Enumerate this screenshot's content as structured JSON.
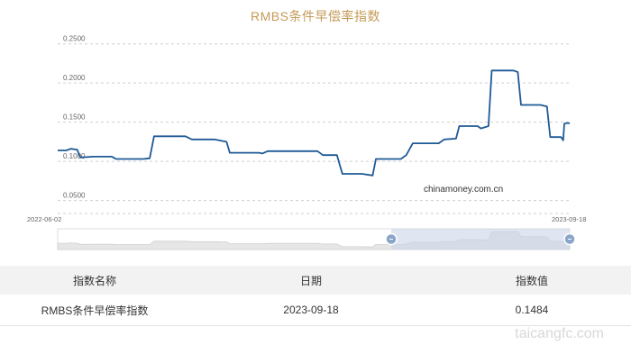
{
  "chart_data": {
    "type": "line",
    "title": "RMBS条件早偿率指数",
    "x_start": "2022-06-02",
    "x_end": "2023-09-18",
    "ylim": [
      0.03,
      0.26
    ],
    "yticks": [
      "0.0500",
      "0.1000",
      "0.1500",
      "0.2000",
      "0.2500"
    ],
    "ytick_values": [
      0.05,
      0.1,
      0.15,
      0.2,
      0.25
    ],
    "grid": true,
    "watermark": "chinamoney.com.cn",
    "series": [
      {
        "points": [
          [
            "2022-06-02",
            0.114
          ],
          [
            "2022-06-10",
            0.114
          ],
          [
            "2022-06-14",
            0.116
          ],
          [
            "2022-06-20",
            0.115
          ],
          [
            "2022-06-23",
            0.105
          ],
          [
            "2022-07-05",
            0.106
          ],
          [
            "2022-07-22",
            0.106
          ],
          [
            "2022-07-26",
            0.103
          ],
          [
            "2022-08-20",
            0.103
          ],
          [
            "2022-08-26",
            0.104
          ],
          [
            "2022-08-30",
            0.132
          ],
          [
            "2022-09-28",
            0.132
          ],
          [
            "2022-10-04",
            0.128
          ],
          [
            "2022-10-25",
            0.128
          ],
          [
            "2022-11-01",
            0.126
          ],
          [
            "2022-11-05",
            0.125
          ],
          [
            "2022-11-08",
            0.111
          ],
          [
            "2022-12-05",
            0.111
          ],
          [
            "2022-12-08",
            0.11
          ],
          [
            "2022-12-13",
            0.113
          ],
          [
            "2023-01-28",
            0.113
          ],
          [
            "2023-02-02",
            0.108
          ],
          [
            "2023-02-15",
            0.108
          ],
          [
            "2023-02-20",
            0.084
          ],
          [
            "2023-03-10",
            0.084
          ],
          [
            "2023-03-20",
            0.082
          ],
          [
            "2023-03-23",
            0.103
          ],
          [
            "2023-04-15",
            0.103
          ],
          [
            "2023-04-20",
            0.108
          ],
          [
            "2023-04-26",
            0.123
          ],
          [
            "2023-05-20",
            0.123
          ],
          [
            "2023-05-25",
            0.128
          ],
          [
            "2023-06-05",
            0.129
          ],
          [
            "2023-06-08",
            0.145
          ],
          [
            "2023-06-25",
            0.145
          ],
          [
            "2023-06-28",
            0.142
          ],
          [
            "2023-07-05",
            0.145
          ],
          [
            "2023-07-08",
            0.216
          ],
          [
            "2023-07-28",
            0.216
          ],
          [
            "2023-08-01",
            0.214
          ],
          [
            "2023-08-04",
            0.172
          ],
          [
            "2023-08-22",
            0.172
          ],
          [
            "2023-08-28",
            0.17
          ],
          [
            "2023-08-31",
            0.131
          ],
          [
            "2023-09-10",
            0.131
          ],
          [
            "2023-09-12",
            0.127
          ],
          [
            "2023-09-13",
            0.148
          ],
          [
            "2023-09-16",
            0.149
          ],
          [
            "2023-09-18",
            0.1484
          ]
        ]
      }
    ]
  },
  "table": {
    "headers": {
      "name": "指数名称",
      "date": "日期",
      "value": "指数值"
    },
    "rows": [
      {
        "name": "RMBS条件早偿率指数",
        "date": "2023-09-18",
        "value": "0.1484"
      }
    ]
  },
  "site_mark": "taicangfc.com",
  "colors": {
    "line": "#1f5a96",
    "title": "#c49a56",
    "navigator_fill": "#e6e6e6",
    "navigator_selected": "#c9d6ea",
    "handle": "#8aa5c8"
  }
}
